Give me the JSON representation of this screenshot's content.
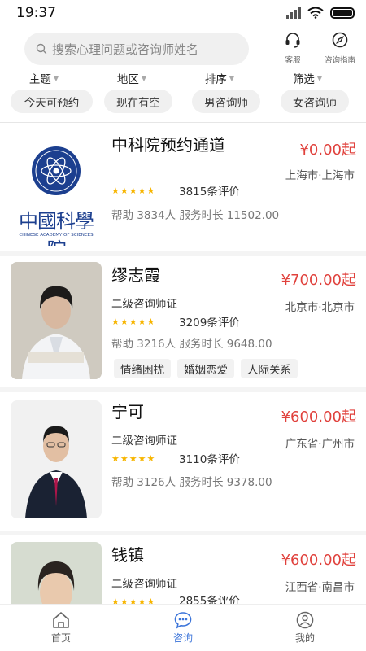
{
  "status": {
    "time": "19:37"
  },
  "search": {
    "placeholder": "搜索心理问题或咨询师姓名"
  },
  "top_tools": [
    {
      "label": "客服",
      "icon": "headset-icon"
    },
    {
      "label": "咨询指南",
      "icon": "compass-icon"
    }
  ],
  "filters": [
    "主题",
    "地区",
    "排序",
    "筛选"
  ],
  "chips": [
    "今天可预约",
    "现在有空",
    "男咨询师",
    "女咨询师"
  ],
  "counselors": [
    {
      "name": "中科院预约通道",
      "price": "¥0.00起",
      "region": "上海市·上海市",
      "cert": "",
      "reviews": "3815条评价",
      "stats": "帮助 3834人 服务时长 11502.00",
      "tags": [],
      "logo_text": "中國科學院",
      "logo_sub": "CHINESE ACADEMY OF SCIENCES"
    },
    {
      "name": "缪志霞",
      "price": "¥700.00起",
      "region": "北京市·北京市",
      "cert": "二级咨询师证",
      "reviews": "3209条评价",
      "stats": "帮助 3216人 服务时长 9648.00",
      "tags": [
        "情绪困扰",
        "婚姻恋爱",
        "人际关系"
      ]
    },
    {
      "name": "宁可",
      "price": "¥600.00起",
      "region": "广东省·广州市",
      "cert": "二级咨询师证",
      "reviews": "3110条评价",
      "stats": "帮助 3126人 服务时长 9378.00",
      "tags": []
    },
    {
      "name": "钱镇",
      "price": "¥600.00起",
      "region": "江西省·南昌市",
      "cert": "二级咨询师证",
      "reviews": "2855条评价",
      "stats": "",
      "tags": []
    }
  ],
  "stars": "★★★★★",
  "nav": [
    {
      "label": "首页",
      "icon": "home-icon"
    },
    {
      "label": "咨询",
      "icon": "chat-icon",
      "active": true
    },
    {
      "label": "我的",
      "icon": "profile-icon"
    }
  ],
  "colors": {
    "price": "#e0413c",
    "accent": "#3a73d9",
    "star": "#f7b500"
  }
}
